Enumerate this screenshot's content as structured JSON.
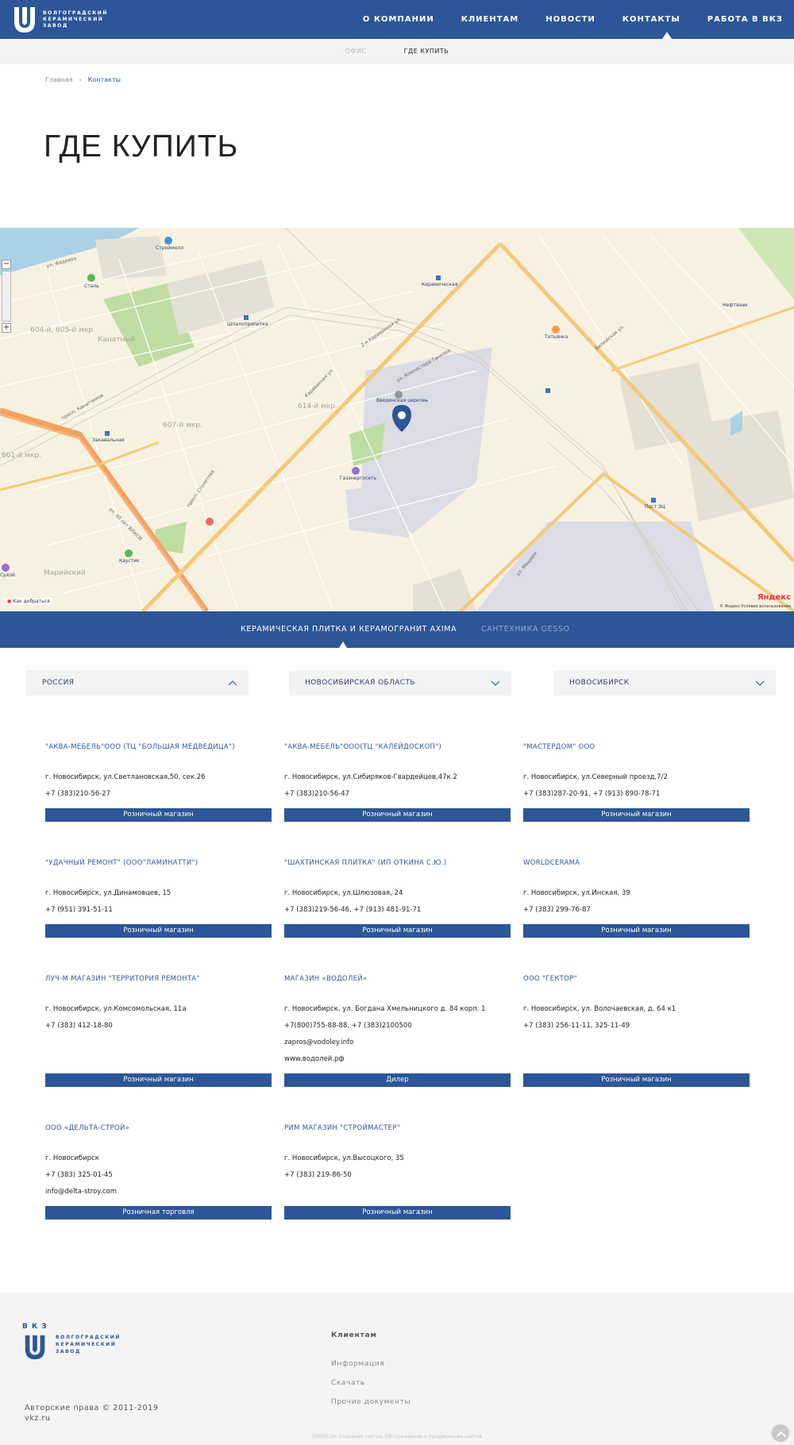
{
  "header": {
    "logo_text": "Волгоградский керамический завод",
    "nav": [
      "О компании",
      "Клиентам",
      "Новости",
      "Контакты",
      "Работа в ВКЗ"
    ],
    "active_nav": "Контакты"
  },
  "subnav": {
    "items": [
      "Офис",
      "Где купить"
    ],
    "current": "Где купить"
  },
  "breadcrumb": {
    "home": "Главная",
    "separator": "›",
    "current": "Контакты"
  },
  "page_title": "ГДЕ КУПИТЬ",
  "map": {
    "poi": [
      "Строймолл",
      "Сталь",
      "Шпалопропитка",
      "Керамическая",
      "Татьянка",
      "Введенская церковь",
      "Закавальная",
      "Газэнергосеть",
      "Пост ЭЦ",
      "Каустик",
      "Нефтяник",
      "Сухой"
    ],
    "districts": [
      "Канатный",
      "604-й, 605-й мкр.",
      "607-й мкр.",
      "614-й мкр.",
      "601-й мкр.",
      "Марийский"
    ],
    "streets": [
      "ул. Фадеева",
      "2-я Караванная ул.",
      "Караванная ул.",
      "ул. Мещеря",
      "Вилюйская ул.",
      "ул. 40 лет ВЛКСМ",
      "просп. Столетова",
      "ул. Компостера Танкова",
      "просп. Канатчиков"
    ],
    "route_label": "Как добраться",
    "brand": "Яндекс",
    "terms": "© Яндекс Условия использования",
    "zoom_in": "+",
    "zoom_out": "−"
  },
  "tabs": [
    "Керамическая плитка и керамогранит AXIMA",
    "Сантехника GESSO"
  ],
  "filters": {
    "country": "Россия",
    "region": "Новосибирская область",
    "city": "Новосибирск"
  },
  "stores": [
    {
      "name": "\"АКВА-МЕБЕЛЬ\"ООО (ТЦ \"БОЛЬШАЯ МЕДВЕДИЦА\")",
      "lines": [
        "г. Новосибирск, ул.Светлановская,50, сек.26",
        "+7 (383)210-56-27"
      ],
      "type": "Розничный магазин"
    },
    {
      "name": "\"АКВА-МЕБЕЛЬ\"ООО(ТЦ \"КАЛЕЙДОСКОП\")",
      "lines": [
        "г. Новосибирск, ул.Сибиряков-Гвардейцев,47к.2",
        "+7 (383)210-56-47"
      ],
      "type": "Розничный магазин"
    },
    {
      "name": "\"МАСТЕРДОМ\" ООО",
      "lines": [
        "г. Новосибирск, ул.Северный проезд,7/2",
        "+7 (383)287-20-91, +7 (913) 890-78-71"
      ],
      "type": "Розничный магазин"
    },
    {
      "name": "\"УДАЧНЫЙ РЕМОНТ\" (ООО\"ЛАМИНАТТИ\")",
      "lines": [
        "г. Новосибирск, ул.Динамовцев, 15",
        "+7 (951) 391-51-11"
      ],
      "type": "Розничный магазин"
    },
    {
      "name": "\"ШАХТИНСКАЯ ПЛИТКА\" (ИП ОТКИНА С.Ю.)",
      "lines": [
        "г. Новосибирск, ул.Шлюзовая, 24",
        "+7 (383)219-56-46, +7 (913) 481-91-71"
      ],
      "type": "Розничный магазин"
    },
    {
      "name": "WORLDCERAMA",
      "lines": [
        "г. Новосибирск, ул.Инская, 39",
        "+7 (383) 299-76-87"
      ],
      "type": "Розничный магазин"
    },
    {
      "name": "ЛУЧ-М МАГАЗИН \"ТЕРРИТОРИЯ РЕМОНТА\"",
      "lines": [
        "г. Новосибирск, ул.Комсомольская, 11а",
        "+7 (383) 412-18-80"
      ],
      "type": "Розничный магазин"
    },
    {
      "name": "МАГАЗИН «ВОДОЛЕЙ»",
      "lines": [
        "г. Новосибирск, ул. Богдана Хмельницкого д. 84 корп. 1",
        "+7(800)755-88-88, +7 (383)2100500",
        "zapros@vodoley.info",
        "www.водолей.рф"
      ],
      "type": "Дилер"
    },
    {
      "name": "ООО \"ГЕКТОР\"",
      "lines": [
        "г. Новосибирск, ул. Волочаевская, д. 64 к1",
        "+7 (383) 256-11-11, 325-11-49"
      ],
      "type": "Розничный магазин"
    },
    {
      "name": "ООО «ДЕЛЬТА-СТРОЙ»",
      "lines": [
        "г. Новосибирск",
        "+7 (383) 325-01-45",
        "info@delta-stroy.com"
      ],
      "type": "Розничная торговля"
    },
    {
      "name": "РИМ МАГАЗИН \"СТРОЙМАСТЕР\"",
      "lines": [
        "г. Новосибирск, ул.Высоцкого, 35",
        "+7 (383) 219-86-50"
      ],
      "type": "Розничный магазин"
    }
  ],
  "footer": {
    "logo_abbr": "ВКЗ",
    "logo_text": "Волгоградский керамический завод",
    "heading": "Клиентам",
    "links": [
      "Информация",
      "Скачать",
      "Прочие документы"
    ],
    "copyright": "Авторские права © 2011-2019",
    "site": "vkz.ru",
    "credits": "ONVOLGA: Создание сайтов, Обслуживание и продвижение сайтов"
  },
  "colors": {
    "brand": "#2c5697",
    "map_bg": "#f7f1e1",
    "road": "#f5c978",
    "footer_bg": "#f4f4f4"
  }
}
